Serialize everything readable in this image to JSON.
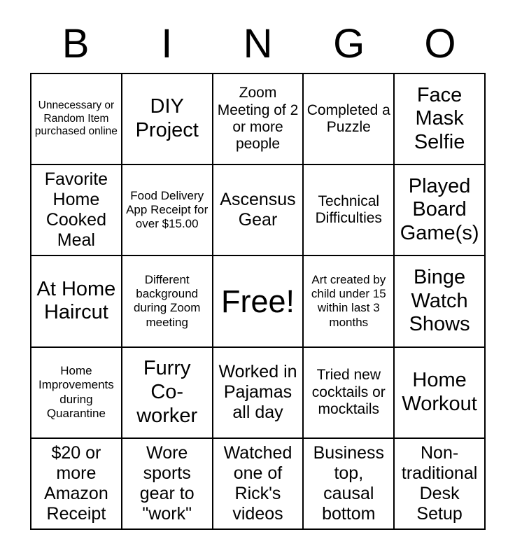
{
  "header": {
    "letters": [
      "B",
      "I",
      "N",
      "G",
      "O"
    ]
  },
  "grid": {
    "rows": 5,
    "columns": 5,
    "border_color": "#000000",
    "background_color": "#ffffff",
    "text_color": "#000000",
    "cells": [
      {
        "text": "Unnecessary or Random Item purchased online",
        "size": "xxs"
      },
      {
        "text": "DIY Project",
        "size": "lg"
      },
      {
        "text": "Zoom Meeting of 2 or more people",
        "size": "sm"
      },
      {
        "text": "Completed a Puzzle",
        "size": "sm"
      },
      {
        "text": "Face Mask Selfie",
        "size": "lg"
      },
      {
        "text": "Favorite Home Cooked Meal",
        "size": "md"
      },
      {
        "text": "Food Delivery App Receipt for over $15.00",
        "size": "xs"
      },
      {
        "text": "Ascensus Gear",
        "size": "md"
      },
      {
        "text": "Technical Difficulties",
        "size": "sm"
      },
      {
        "text": "Played Board Game(s)",
        "size": "lg"
      },
      {
        "text": "At Home Haircut",
        "size": "lg"
      },
      {
        "text": "Different background during Zoom meeting",
        "size": "xs"
      },
      {
        "text": "Free!",
        "size": "xl"
      },
      {
        "text": "Art created by child under 15 within last 3 months",
        "size": "xs"
      },
      {
        "text": "Binge Watch Shows",
        "size": "lg"
      },
      {
        "text": "Home Improvements during Quarantine",
        "size": "xs"
      },
      {
        "text": "Furry Co-worker",
        "size": "lg"
      },
      {
        "text": "Worked in Pajamas all day",
        "size": "md"
      },
      {
        "text": "Tried new cocktails or mocktails",
        "size": "sm"
      },
      {
        "text": "Home Workout",
        "size": "lg"
      },
      {
        "text": "$20 or more Amazon Receipt",
        "size": "md"
      },
      {
        "text": "Wore sports gear to \"work\"",
        "size": "md"
      },
      {
        "text": "Watched one of Rick's videos",
        "size": "md"
      },
      {
        "text": "Business top, causal bottom",
        "size": "md"
      },
      {
        "text": "Non-traditional Desk Setup",
        "size": "md"
      }
    ]
  }
}
